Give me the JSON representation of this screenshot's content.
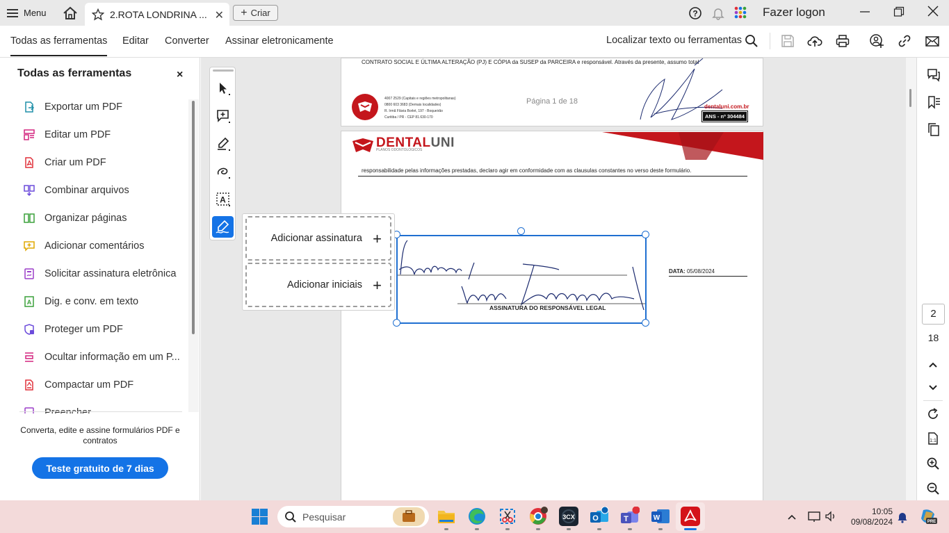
{
  "titlebar": {
    "menu_label": "Menu",
    "tab_title": "2.ROTA LONDRINA ...",
    "tab_close": "✕",
    "create_label": "Criar",
    "login_label": "Fazer logon"
  },
  "toolbar": {
    "items": [
      "Todas as ferramentas",
      "Editar",
      "Converter",
      "Assinar eletronicamente"
    ],
    "search_label": "Localizar texto ou ferramentas"
  },
  "left_panel": {
    "title": "Todas as ferramentas",
    "close": "×",
    "tools": [
      {
        "label": "Exportar um PDF",
        "icon": "export-pdf-icon",
        "color": "#1f8fa8"
      },
      {
        "label": "Editar um PDF",
        "icon": "edit-pdf-icon",
        "color": "#d4247f"
      },
      {
        "label": "Criar um PDF",
        "icon": "create-pdf-icon",
        "color": "#e0303a"
      },
      {
        "label": "Combinar arquivos",
        "icon": "combine-files-icon",
        "color": "#6c4cdb"
      },
      {
        "label": "Organizar páginas",
        "icon": "organize-pages-icon",
        "color": "#3aa13a"
      },
      {
        "label": "Adicionar comentários",
        "icon": "add-comment-icon",
        "color": "#e0a800"
      },
      {
        "label": "Solicitar assinatura eletrônica",
        "icon": "request-signature-icon",
        "color": "#9b3fc9"
      },
      {
        "label": "Dig. e conv. em texto",
        "icon": "scan-ocr-icon",
        "color": "#3aa13a"
      },
      {
        "label": "Proteger um PDF",
        "icon": "protect-pdf-icon",
        "color": "#6c4cdb"
      },
      {
        "label": "Ocultar informação em um P...",
        "icon": "redact-icon",
        "color": "#d4247f"
      },
      {
        "label": "Compactar um PDF",
        "icon": "compress-pdf-icon",
        "color": "#e0303a"
      },
      {
        "label": "Preencher",
        "icon": "fill-sign-icon",
        "color": "#9b3fc9"
      }
    ],
    "promo_text": "Converta, edite e assine formulários PDF e contratos",
    "trial_button": "Teste gratuito de 7 dias"
  },
  "signature_popup": {
    "add_signature": "Adicionar assinatura",
    "add_initials": "Adicionar iniciais"
  },
  "document": {
    "page1_text": "CONTRATO SOCIAL E ÚLTIMA ALTERAÇÃO (PJ) E CÓPIA da SUSEP da PARCEIRA e responsável. Através da presente, assumo total",
    "page1_contact": [
      "4007 2529 (Capitais e regiões metropolitanas)",
      "0800 603 3683 (Demais localidades)",
      "R. Irmã Flávia Borlet, 197 - Boqueirão",
      "Curitiba / PR - CEP 81.630-170"
    ],
    "page1_pagenum": "Página 1 de 18",
    "page1_site": "dentaluni.com.br",
    "page1_ans": "ANS - nº 304484",
    "brand_name_a": "DENTAL",
    "brand_name_b": "UNI",
    "brand_sub": "PLANOS ODONTOLÓGICOS",
    "page2_text": "responsabilidade pelas informações prestadas, declaro agir em conformidade com as clausulas constantes no verso deste formulário.",
    "date_label": "DATA:",
    "date_value": "05/08/2024",
    "signature_caption": "ASSINATURA DO RESPONSÁVEL LEGAL"
  },
  "page_nav": {
    "current": "2",
    "total": "18"
  },
  "taskbar": {
    "search_placeholder": "Pesquisar",
    "time": "10:05",
    "date": "09/08/2024"
  },
  "colors": {
    "accent": "#1473e6",
    "brand_red": "#c4161c",
    "selection": "#1f6fd1"
  }
}
